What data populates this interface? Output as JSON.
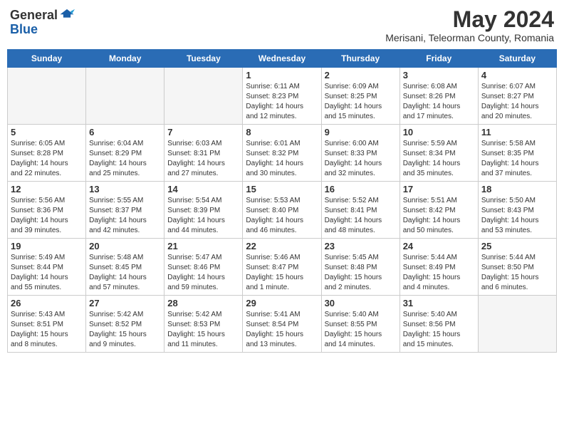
{
  "header": {
    "logo_general": "General",
    "logo_blue": "Blue",
    "month_title": "May 2024",
    "location": "Merisani, Teleorman County, Romania"
  },
  "weekdays": [
    "Sunday",
    "Monday",
    "Tuesday",
    "Wednesday",
    "Thursday",
    "Friday",
    "Saturday"
  ],
  "weeks": [
    [
      {
        "day": "",
        "info": ""
      },
      {
        "day": "",
        "info": ""
      },
      {
        "day": "",
        "info": ""
      },
      {
        "day": "1",
        "info": "Sunrise: 6:11 AM\nSunset: 8:23 PM\nDaylight: 14 hours\nand 12 minutes."
      },
      {
        "day": "2",
        "info": "Sunrise: 6:09 AM\nSunset: 8:25 PM\nDaylight: 14 hours\nand 15 minutes."
      },
      {
        "day": "3",
        "info": "Sunrise: 6:08 AM\nSunset: 8:26 PM\nDaylight: 14 hours\nand 17 minutes."
      },
      {
        "day": "4",
        "info": "Sunrise: 6:07 AM\nSunset: 8:27 PM\nDaylight: 14 hours\nand 20 minutes."
      }
    ],
    [
      {
        "day": "5",
        "info": "Sunrise: 6:05 AM\nSunset: 8:28 PM\nDaylight: 14 hours\nand 22 minutes."
      },
      {
        "day": "6",
        "info": "Sunrise: 6:04 AM\nSunset: 8:29 PM\nDaylight: 14 hours\nand 25 minutes."
      },
      {
        "day": "7",
        "info": "Sunrise: 6:03 AM\nSunset: 8:31 PM\nDaylight: 14 hours\nand 27 minutes."
      },
      {
        "day": "8",
        "info": "Sunrise: 6:01 AM\nSunset: 8:32 PM\nDaylight: 14 hours\nand 30 minutes."
      },
      {
        "day": "9",
        "info": "Sunrise: 6:00 AM\nSunset: 8:33 PM\nDaylight: 14 hours\nand 32 minutes."
      },
      {
        "day": "10",
        "info": "Sunrise: 5:59 AM\nSunset: 8:34 PM\nDaylight: 14 hours\nand 35 minutes."
      },
      {
        "day": "11",
        "info": "Sunrise: 5:58 AM\nSunset: 8:35 PM\nDaylight: 14 hours\nand 37 minutes."
      }
    ],
    [
      {
        "day": "12",
        "info": "Sunrise: 5:56 AM\nSunset: 8:36 PM\nDaylight: 14 hours\nand 39 minutes."
      },
      {
        "day": "13",
        "info": "Sunrise: 5:55 AM\nSunset: 8:37 PM\nDaylight: 14 hours\nand 42 minutes."
      },
      {
        "day": "14",
        "info": "Sunrise: 5:54 AM\nSunset: 8:39 PM\nDaylight: 14 hours\nand 44 minutes."
      },
      {
        "day": "15",
        "info": "Sunrise: 5:53 AM\nSunset: 8:40 PM\nDaylight: 14 hours\nand 46 minutes."
      },
      {
        "day": "16",
        "info": "Sunrise: 5:52 AM\nSunset: 8:41 PM\nDaylight: 14 hours\nand 48 minutes."
      },
      {
        "day": "17",
        "info": "Sunrise: 5:51 AM\nSunset: 8:42 PM\nDaylight: 14 hours\nand 50 minutes."
      },
      {
        "day": "18",
        "info": "Sunrise: 5:50 AM\nSunset: 8:43 PM\nDaylight: 14 hours\nand 53 minutes."
      }
    ],
    [
      {
        "day": "19",
        "info": "Sunrise: 5:49 AM\nSunset: 8:44 PM\nDaylight: 14 hours\nand 55 minutes."
      },
      {
        "day": "20",
        "info": "Sunrise: 5:48 AM\nSunset: 8:45 PM\nDaylight: 14 hours\nand 57 minutes."
      },
      {
        "day": "21",
        "info": "Sunrise: 5:47 AM\nSunset: 8:46 PM\nDaylight: 14 hours\nand 59 minutes."
      },
      {
        "day": "22",
        "info": "Sunrise: 5:46 AM\nSunset: 8:47 PM\nDaylight: 15 hours\nand 1 minute."
      },
      {
        "day": "23",
        "info": "Sunrise: 5:45 AM\nSunset: 8:48 PM\nDaylight: 15 hours\nand 2 minutes."
      },
      {
        "day": "24",
        "info": "Sunrise: 5:44 AM\nSunset: 8:49 PM\nDaylight: 15 hours\nand 4 minutes."
      },
      {
        "day": "25",
        "info": "Sunrise: 5:44 AM\nSunset: 8:50 PM\nDaylight: 15 hours\nand 6 minutes."
      }
    ],
    [
      {
        "day": "26",
        "info": "Sunrise: 5:43 AM\nSunset: 8:51 PM\nDaylight: 15 hours\nand 8 minutes."
      },
      {
        "day": "27",
        "info": "Sunrise: 5:42 AM\nSunset: 8:52 PM\nDaylight: 15 hours\nand 9 minutes."
      },
      {
        "day": "28",
        "info": "Sunrise: 5:42 AM\nSunset: 8:53 PM\nDaylight: 15 hours\nand 11 minutes."
      },
      {
        "day": "29",
        "info": "Sunrise: 5:41 AM\nSunset: 8:54 PM\nDaylight: 15 hours\nand 13 minutes."
      },
      {
        "day": "30",
        "info": "Sunrise: 5:40 AM\nSunset: 8:55 PM\nDaylight: 15 hours\nand 14 minutes."
      },
      {
        "day": "31",
        "info": "Sunrise: 5:40 AM\nSunset: 8:56 PM\nDaylight: 15 hours\nand 15 minutes."
      },
      {
        "day": "",
        "info": ""
      }
    ]
  ]
}
